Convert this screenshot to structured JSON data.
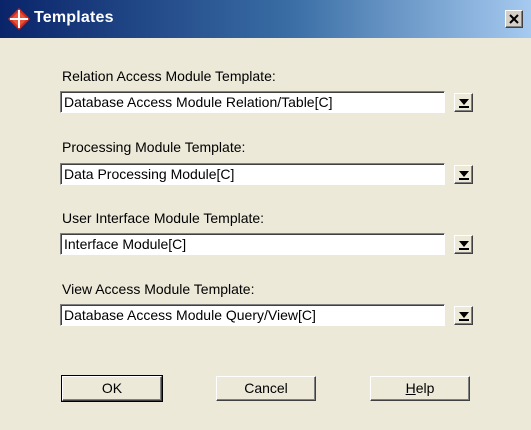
{
  "window": {
    "title": "Templates",
    "icon": "app-diamond-icon",
    "close_icon": "close-icon"
  },
  "fields": [
    {
      "label": "Relation Access Module Template:",
      "value": "Database Access Module Relation/Table[C]"
    },
    {
      "label": "Processing Module Template:",
      "value": "Data Processing Module[C]"
    },
    {
      "label": "User Interface Module Template:",
      "value": "Interface Module[C]"
    },
    {
      "label": "View Access Module Template:",
      "value": "Database Access Module Query/View[C]"
    }
  ],
  "buttons": {
    "ok": "OK",
    "cancel": "Cancel",
    "help_first": "H",
    "help_rest": "elp"
  },
  "colors": {
    "titlebar_start": "#0A246A",
    "titlebar_end": "#A6CAF0",
    "dialog_bg": "#ECE9D8",
    "icon_red": "#D42A1E"
  }
}
